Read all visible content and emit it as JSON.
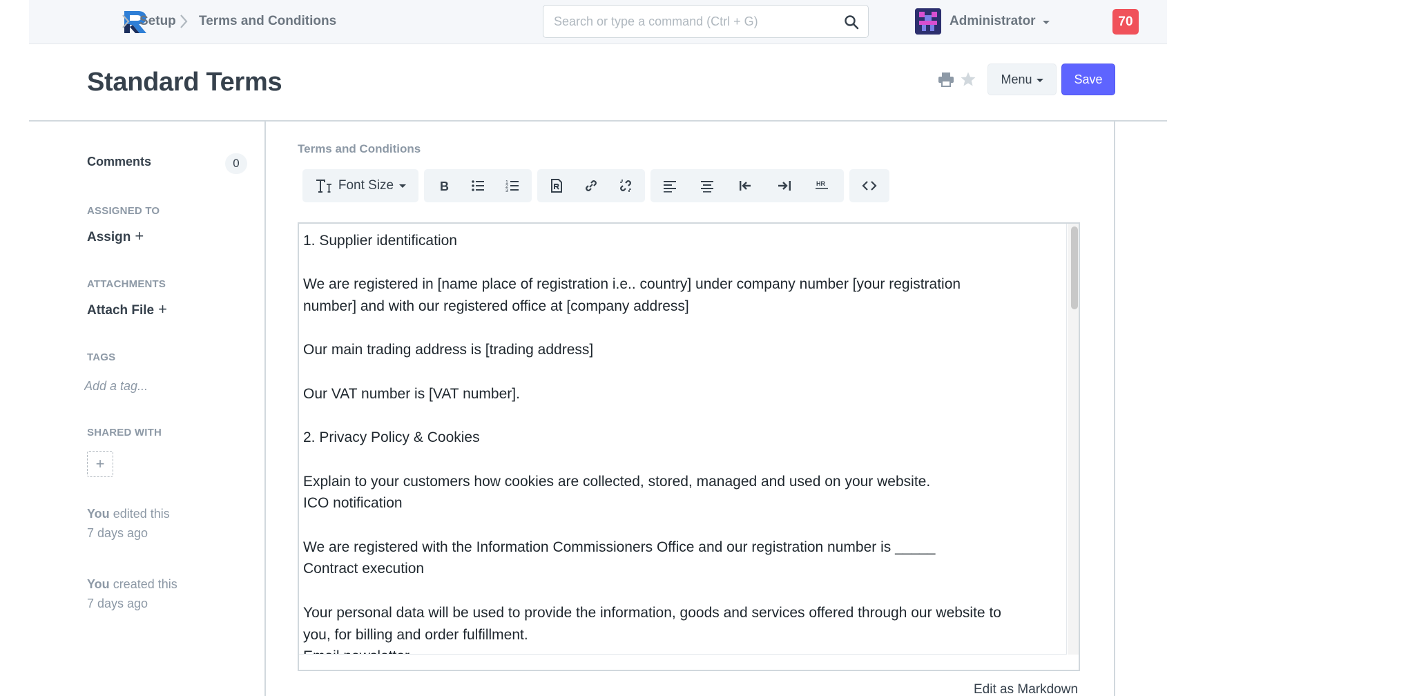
{
  "navbar": {
    "breadcrumbs": [
      "Setup",
      "Terms and Conditions"
    ],
    "search_placeholder": "Search or type a command (Ctrl + G)",
    "user_name": "Administrator",
    "notification_count": "70"
  },
  "page": {
    "title": "Standard Terms",
    "menu_label": "Menu",
    "save_label": "Save"
  },
  "sidebar": {
    "comments_label": "Comments",
    "comments_count": "0",
    "assigned_to_heading": "ASSIGNED TO",
    "assign_label": "Assign",
    "attachments_heading": "ATTACHMENTS",
    "attach_label": "Attach File",
    "tags_heading": "TAGS",
    "tag_placeholder": "Add a tag...",
    "shared_with_heading": "SHARED WITH",
    "activity": [
      {
        "actor": "You",
        "action": "edited this",
        "when": "7 days ago"
      },
      {
        "actor": "You",
        "action": "created this",
        "when": "7 days ago"
      }
    ]
  },
  "editor": {
    "field_label": "Terms and Conditions",
    "font_size_label": "Font Size",
    "edit_markdown_label": "Edit as Markdown",
    "lines": [
      "1. Supplier identification",
      "",
      "We are registered in [name place of registration i.e.. country] under company number [your registration",
      "number] and with our registered office at [company address]",
      "",
      "Our main trading address is [trading address]",
      "",
      "Our VAT number is [VAT number].",
      "",
      "2. Privacy Policy & Cookies",
      "",
      "Explain to your customers how cookies are collected, stored, managed and used on your website.",
      "ICO notification",
      "",
      "We are registered with the Information Commissioners Office and our registration number is _____",
      "Contract execution",
      "",
      "Your personal data will be used to provide the information, goods and services offered through our website to",
      "you, for billing and order fulfillment.",
      "Email newsletter"
    ]
  },
  "colors": {
    "primary": "#5e64ff",
    "badge": "#f0525a",
    "logo_blue": "#2f7fd6",
    "logo_dark": "#1b2e5c"
  }
}
